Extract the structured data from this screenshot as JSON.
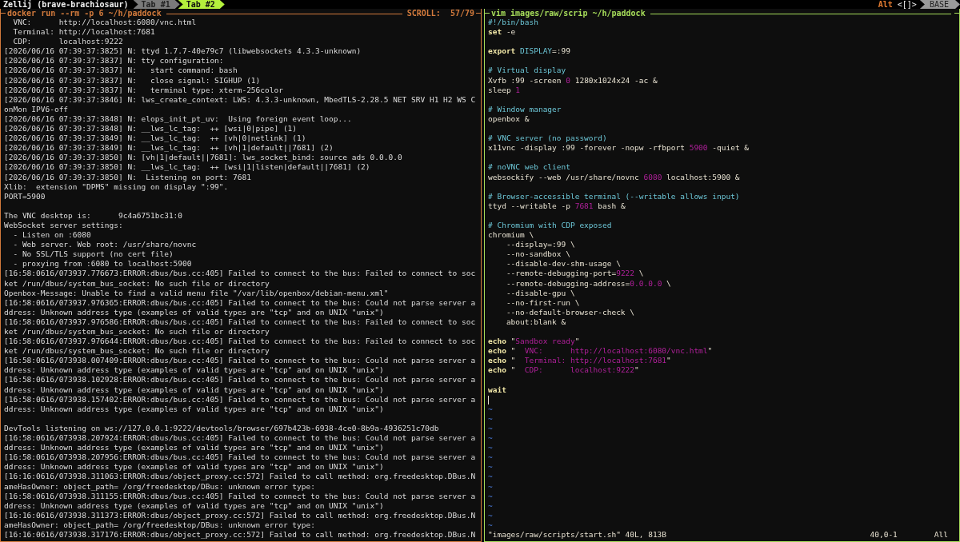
{
  "top_bar": {
    "session": "Zellij (brave-brachiosaur)",
    "tabs": [
      {
        "label": "Tab #1",
        "selected": false
      },
      {
        "label": "Tab #2",
        "selected": true
      }
    ],
    "mode_key": "Alt",
    "mode_hint": "<[]>",
    "mode": "BASE"
  },
  "left_pane": {
    "title": "docker run --rm -p 6 ~/h/paddock",
    "scroll": "SCROLL:  57/79",
    "blocks": [
      [
        "  VNC:      http://localhost:6080/vnc.html",
        "  Terminal: http://localhost:7681",
        "  CDP:      localhost:9222",
        "[2026/06/16 07:39:37:3825] N: ttyd 1.7.7-40e79c7 (libwebsockets 4.3.3-unknown)",
        "[2026/06/16 07:39:37:3837] N: tty configuration:",
        "[2026/06/16 07:39:37:3837] N:   start command: bash",
        "[2026/06/16 07:39:37:3837] N:   close signal: SIGHUP (1)",
        "[2026/06/16 07:39:37:3837] N:   terminal type: xterm-256color",
        "[2026/06/16 07:39:37:3846] N: lws_create_context: LWS: 4.3.3-unknown, MbedTLS-2.28.5 NET SRV H1 H2 WS C",
        "onMon IPV6-off",
        "[2026/06/16 07:39:37:3848] N: elops_init_pt_uv:  Using foreign event loop...",
        "[2026/06/16 07:39:37:3848] N: __lws_lc_tag:  ++ [wsi|0|pipe] (1)",
        "[2026/06/16 07:39:37:3849] N: __lws_lc_tag:  ++ [vh|0|netlink] (1)",
        "[2026/06/16 07:39:37:3849] N: __lws_lc_tag:  ++ [vh|1|default||7681] (2)",
        "[2026/06/16 07:39:37:3850] N: [vh|1|default||7681]: lws_socket_bind: source ads 0.0.0.0",
        "[2026/06/16 07:39:37:3850] N: __lws_lc_tag:  ++ [wsi|1|listen|default||7681] (2)",
        "[2026/06/16 07:39:37:3850] N:  Listening on port: 7681",
        "Xlib:  extension \"DPMS\" missing on display \":99\".",
        "PORT=5900"
      ],
      [
        "The VNC desktop is:      9c4a6751bc31:0",
        "WebSocket server settings:",
        "  - Listen on :6080",
        "  - Web server. Web root: /usr/share/novnc",
        "  - No SSL/TLS support (no cert file)",
        "  - proxying from :6080 to localhost:5900",
        "[16:58:0616/073937.776673:ERROR:dbus/bus.cc:405] Failed to connect to the bus: Failed to connect to soc",
        "ket /run/dbus/system_bus_socket: No such file or directory",
        "Openbox-Message: Unable to find a valid menu file \"/var/lib/openbox/debian-menu.xml\"",
        "[16:58:0616/073937.976365:ERROR:dbus/bus.cc:405] Failed to connect to the bus: Could not parse server a",
        "ddress: Unknown address type (examples of valid types are \"tcp\" and on UNIX \"unix\")",
        "[16:58:0616/073937.976586:ERROR:dbus/bus.cc:405] Failed to connect to the bus: Failed to connect to soc",
        "ket /run/dbus/system_bus_socket: No such file or directory",
        "[16:58:0616/073937.976644:ERROR:dbus/bus.cc:405] Failed to connect to the bus: Failed to connect to soc",
        "ket /run/dbus/system_bus_socket: No such file or directory",
        "[16:58:0616/073938.007409:ERROR:dbus/bus.cc:405] Failed to connect to the bus: Could not parse server a",
        "ddress: Unknown address type (examples of valid types are \"tcp\" and on UNIX \"unix\")",
        "[16:58:0616/073938.102928:ERROR:dbus/bus.cc:405] Failed to connect to the bus: Could not parse server a",
        "ddress: Unknown address type (examples of valid types are \"tcp\" and on UNIX \"unix\")",
        "[16:58:0616/073938.157402:ERROR:dbus/bus.cc:405] Failed to connect to the bus: Could not parse server a",
        "ddress: Unknown address type (examples of valid types are \"tcp\" and on UNIX \"unix\")"
      ],
      [
        "DevTools listening on ws://127.0.0.1:9222/devtools/browser/697b423b-6938-4ce0-8b9a-4936251c70db",
        "[16:58:0616/073938.207924:ERROR:dbus/bus.cc:405] Failed to connect to the bus: Could not parse server a",
        "ddress: Unknown address type (examples of valid types are \"tcp\" and on UNIX \"unix\")",
        "[16:58:0616/073938.207956:ERROR:dbus/bus.cc:405] Failed to connect to the bus: Could not parse server a",
        "ddress: Unknown address type (examples of valid types are \"tcp\" and on UNIX \"unix\")",
        "[16:16:0616/073938.311063:ERROR:dbus/object_proxy.cc:572] Failed to call method: org.freedesktop.DBus.N",
        "ameHasOwner: object_path= /org/freedesktop/DBus: unknown error type:",
        "[16:58:0616/073938.311155:ERROR:dbus/bus.cc:405] Failed to connect to the bus: Could not parse server a",
        "ddress: Unknown address type (examples of valid types are \"tcp\" and on UNIX \"unix\")",
        "[16:16:0616/073938.311373:ERROR:dbus/object_proxy.cc:572] Failed to call method: org.freedesktop.DBus.N",
        "ameHasOwner: object_path= /org/freedesktop/DBus: unknown error type:",
        "[16:16:0616/073938.317176:ERROR:dbus/object_proxy.cc:572] Failed to call method: org.freedesktop.DBus.N"
      ]
    ]
  },
  "right_pane": {
    "title": "vim images/raw/scrip ~/h/paddock",
    "blocks": [
      [
        [
          {
            "kind": "comment",
            "text": "#!/bin/bash"
          }
        ],
        [
          {
            "kind": "statement",
            "text": "set"
          },
          {
            "kind": "plain",
            "text": " -e"
          }
        ]
      ],
      [
        [
          {
            "kind": "statement",
            "text": "export "
          },
          {
            "kind": "ident",
            "text": "DISPLAY"
          },
          {
            "kind": "plain",
            "text": "=:99"
          }
        ]
      ],
      [
        [
          {
            "kind": "comment",
            "text": "# Virtual display"
          }
        ],
        [
          {
            "kind": "plain",
            "text": "Xvfb :99 -screen "
          },
          {
            "kind": "number",
            "text": "0"
          },
          {
            "kind": "plain",
            "text": " 1280x1024x24 -ac &"
          }
        ],
        [
          {
            "kind": "plain",
            "text": "sleep "
          },
          {
            "kind": "number",
            "text": "1"
          }
        ]
      ],
      [
        [
          {
            "kind": "comment",
            "text": "# Window manager"
          }
        ],
        [
          {
            "kind": "plain",
            "text": "openbox &"
          }
        ]
      ],
      [
        [
          {
            "kind": "comment",
            "text": "# VNC server (no password)"
          }
        ],
        [
          {
            "kind": "plain",
            "text": "x11vnc -display :99 -forever -nopw -rfbport "
          },
          {
            "kind": "number",
            "text": "5900"
          },
          {
            "kind": "plain",
            "text": " -quiet &"
          }
        ]
      ],
      [
        [
          {
            "kind": "comment",
            "text": "# noVNC web client"
          }
        ],
        [
          {
            "kind": "plain",
            "text": "websockify --web /usr/share/novnc "
          },
          {
            "kind": "number",
            "text": "6080"
          },
          {
            "kind": "plain",
            "text": " localhost:5900 &"
          }
        ]
      ],
      [
        [
          {
            "kind": "comment",
            "text": "# Browser-accessible terminal (--writable allows input)"
          }
        ],
        [
          {
            "kind": "plain",
            "text": "ttyd --writable -p "
          },
          {
            "kind": "number",
            "text": "7681"
          },
          {
            "kind": "plain",
            "text": " bash &"
          }
        ]
      ],
      [
        [
          {
            "kind": "comment",
            "text": "# Chromium with CDP exposed"
          }
        ],
        [
          {
            "kind": "plain",
            "text": "chromium \\"
          }
        ],
        [
          {
            "kind": "plain",
            "text": "    --display=:99 \\"
          }
        ],
        [
          {
            "kind": "plain",
            "text": "    --no-sandbox \\"
          }
        ],
        [
          {
            "kind": "plain",
            "text": "    --disable-dev-shm-usage \\"
          }
        ],
        [
          {
            "kind": "plain",
            "text": "    --remote-debugging-port="
          },
          {
            "kind": "number",
            "text": "9222"
          },
          {
            "kind": "plain",
            "text": " \\"
          }
        ],
        [
          {
            "kind": "plain",
            "text": "    --remote-debugging-address="
          },
          {
            "kind": "number",
            "text": "0.0.0.0"
          },
          {
            "kind": "plain",
            "text": " \\"
          }
        ],
        [
          {
            "kind": "plain",
            "text": "    --disable-gpu \\"
          }
        ],
        [
          {
            "kind": "plain",
            "text": "    --no-first-run \\"
          }
        ],
        [
          {
            "kind": "plain",
            "text": "    --no-default-browser-check \\"
          }
        ],
        [
          {
            "kind": "plain",
            "text": "    about:blank &"
          }
        ]
      ],
      [
        [
          {
            "kind": "statement",
            "text": "echo"
          },
          {
            "kind": "plain",
            "text": " \""
          },
          {
            "kind": "string",
            "text": "Sandbox ready"
          },
          {
            "kind": "plain",
            "text": "\""
          }
        ],
        [
          {
            "kind": "statement",
            "text": "echo"
          },
          {
            "kind": "plain",
            "text": " \""
          },
          {
            "kind": "string",
            "text": "  VNC:      http://localhost:6080/vnc.html"
          },
          {
            "kind": "plain",
            "text": "\""
          }
        ],
        [
          {
            "kind": "statement",
            "text": "echo"
          },
          {
            "kind": "plain",
            "text": " \""
          },
          {
            "kind": "string",
            "text": "  Terminal: http://localhost:7681"
          },
          {
            "kind": "plain",
            "text": "\""
          }
        ],
        [
          {
            "kind": "statement",
            "text": "echo"
          },
          {
            "kind": "plain",
            "text": " \""
          },
          {
            "kind": "string",
            "text": "  CDP:      localhost:9222"
          },
          {
            "kind": "plain",
            "text": "\""
          }
        ]
      ],
      [
        [
          {
            "kind": "statement",
            "text": "wait"
          }
        ]
      ]
    ],
    "cursor_line": true,
    "filler_lines": [
      "~",
      "~",
      "~",
      "~",
      "~",
      "~",
      "~",
      "~",
      "~",
      "~",
      "~",
      "~",
      "~"
    ],
    "status": {
      "file": "\"images/raw/scripts/start.sh\" 40L, 813B",
      "position": "40,0-1",
      "scroll": "All"
    }
  }
}
